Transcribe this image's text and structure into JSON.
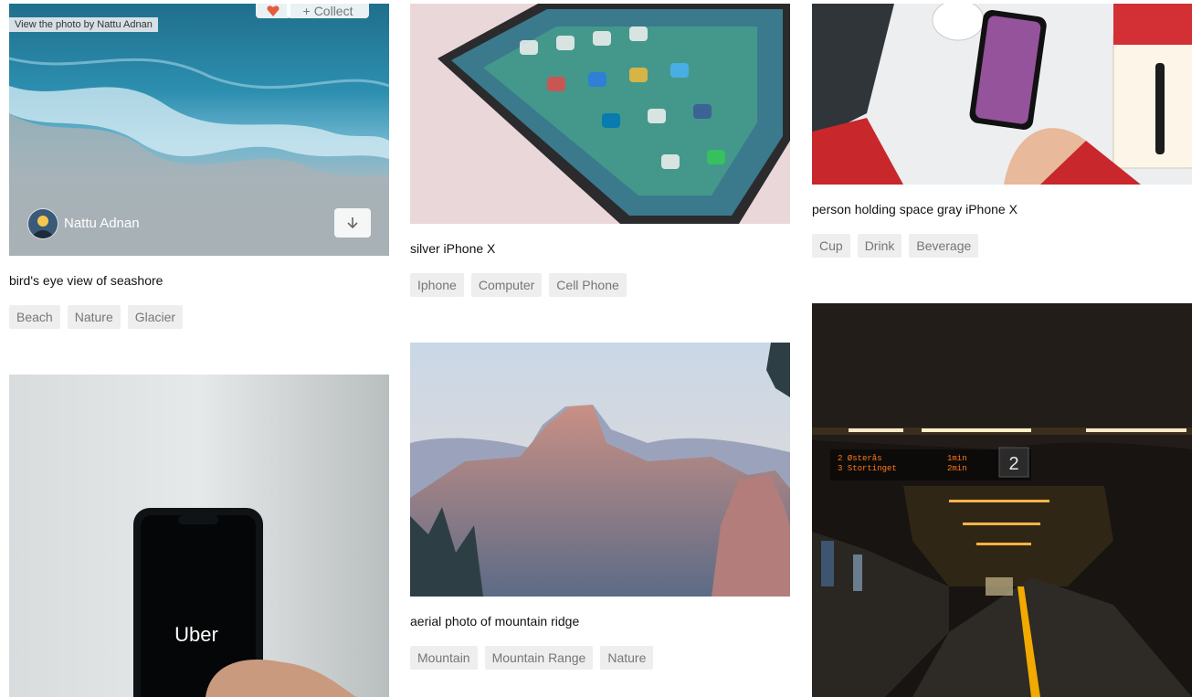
{
  "tooltip": "View the photo by Nattu Adnan",
  "cards": {
    "seashore": {
      "author": "Nattu Adnan",
      "caption": "bird's eye view of seashore",
      "tags": [
        "Beach",
        "Nature",
        "Glacier"
      ],
      "collect_label": "Collect"
    },
    "iphone_silver": {
      "caption": "silver iPhone X",
      "tags": [
        "Iphone",
        "Computer",
        "Cell Phone"
      ]
    },
    "person_iphone": {
      "caption": "person holding space gray iPhone X",
      "tags": [
        "Cup",
        "Drink",
        "Beverage"
      ]
    },
    "uber": {
      "screen_text": "Uber"
    },
    "mountain": {
      "caption": "aerial photo of mountain ridge",
      "tags": [
        "Mountain",
        "Mountain Range",
        "Nature"
      ]
    },
    "subway": {
      "sign_line1": "2 Østerås",
      "sign_line2": "3 Stortinget",
      "sign_time1": "1min",
      "sign_time2": "2min",
      "platform_number": "2"
    }
  },
  "icons": {
    "download": "download-arrow-icon",
    "heart": "heart-icon",
    "plus": "plus-icon"
  },
  "colors": {
    "tag_bg": "#eeeeee",
    "tag_text": "#767676",
    "like_red": "#e25c3d"
  }
}
